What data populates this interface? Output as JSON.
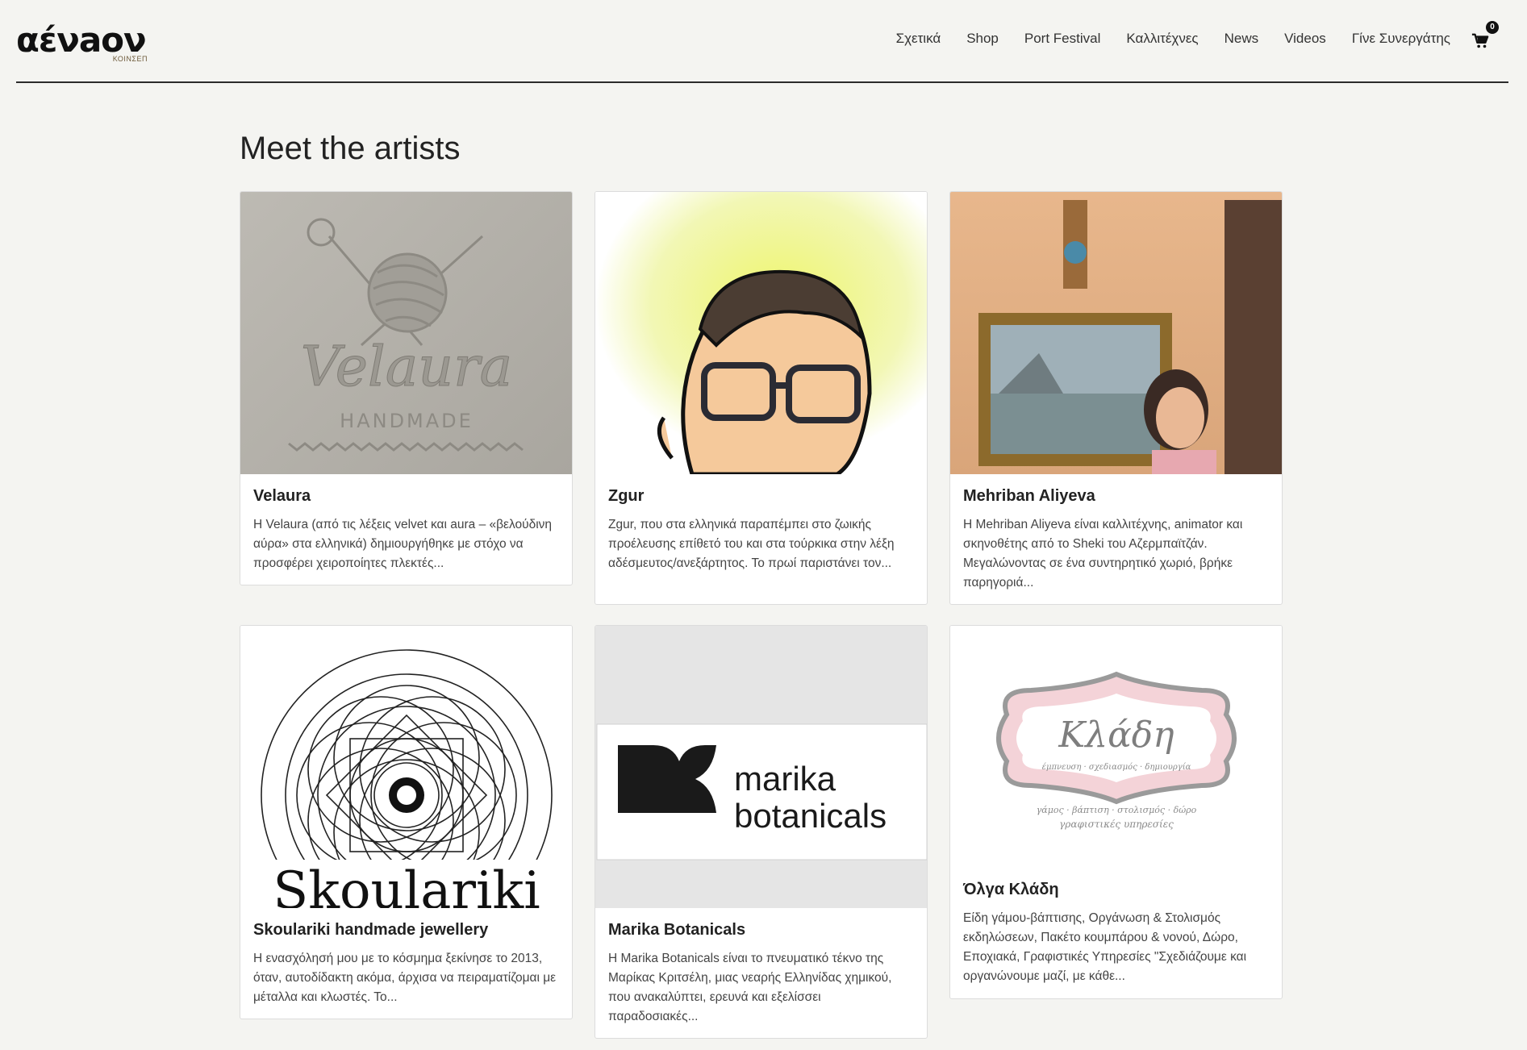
{
  "logo": {
    "wordmark": "αένaoν",
    "subtitle": "ΚΟΙΝΣΕΠ"
  },
  "nav": {
    "items": [
      "Σχετικά",
      "Shop",
      "Port Festival",
      "Καλλιτέχνες",
      "News",
      "Videos",
      "Γίνε Συνεργάτης"
    ],
    "cart_count": "0"
  },
  "page": {
    "title": "Meet the artists"
  },
  "artists": [
    {
      "name": "Velaura",
      "description": "Η Velaura (από τις λέξεις velvet και aura – «βελούδινη αύρα» στα ελληνικά) δημιουργήθηκε με στόχο να προσφέρει χειροποίητες πλεκτές...",
      "image_text": [
        "Velaura",
        "HANDMADE"
      ]
    },
    {
      "name": "Zgur",
      "description": "Zgur, που στα ελληνικά παραπέμπει στο ζωικής προέλευσης επίθετό του και στα τούρκικα στην λέξη αδέσμευτος/ανεξάρτητος. Το πρωί παριστάνει τον..."
    },
    {
      "name": "Mehriban Aliyeva",
      "description": "H Mehriban Aliyeva είναι καλλιτέχνης, animator και σκηνοθέτης από το Sheki του Αζερμπαϊτζάν. Μεγαλώνοντας σε ένα συντηρητικό χωριό, βρήκε παρηγοριά..."
    },
    {
      "name": "Skoulariki handmade jewellery",
      "description": "Η ενασχόλησή μου με το κόσμημα ξεκίνησε το 2013, όταν, αυτοδίδακτη ακόμα, άρχισα να πειραματίζομαι με μέταλλα και κλωστές. Το...",
      "image_text": [
        "Skoulariki"
      ]
    },
    {
      "name": "Marika Botanicals",
      "description": "H Marika Botanicals είναι το πνευματικό τέκνο της Μαρίκας Κριτσέλη, μιας νεαρής Ελληνίδας χημικού, που ανακαλύπτει, ερευνά και εξελίσσει παραδοσιακές...",
      "image_text": [
        "marika",
        "botanicals"
      ]
    },
    {
      "name": "Όλγα Κλάδη",
      "description": "Είδη γάμου-βάπτισης, Οργάνωση & Στολισμός εκδηλώσεων, Πακέτο κουμπάρου & νονού, Δώρο, Εποχιακά, Γραφιστικές Υπηρεσίες \"Σχεδιάζουμε και οργανώνουμε μαζί, με κάθε...",
      "image_text": [
        "Κλάδη",
        "έμπνευση · σχεδιασμός · δημιουργία",
        "γάμος · βάπτιση · στολισμός · δώρο",
        "γραφιστικές υπηρεσίες"
      ]
    }
  ]
}
